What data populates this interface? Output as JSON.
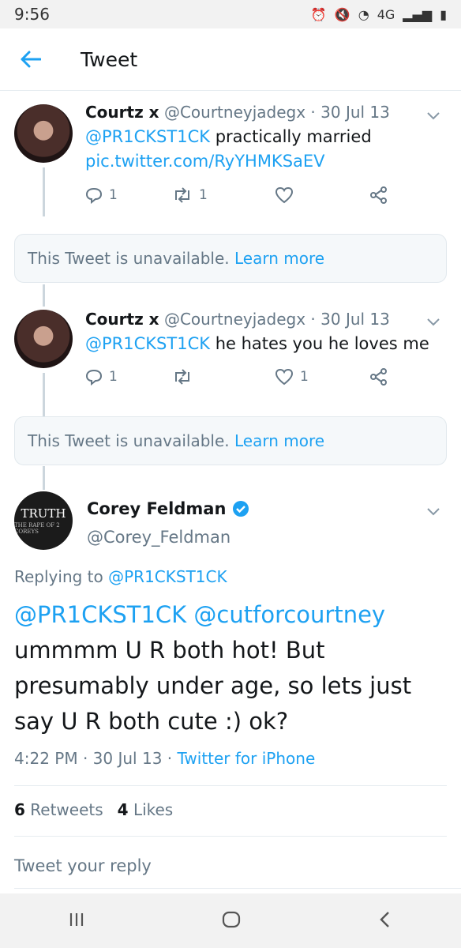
{
  "status_bar": {
    "time": "9:56",
    "network": "4G"
  },
  "app_bar": {
    "title": "Tweet"
  },
  "tweets": [
    {
      "name": "Courtz x",
      "handle": "@Courtneyjadegx",
      "sep": "·",
      "date": "30 Jul 13",
      "mention": "@PR1CKST1CK",
      "text": "practically married",
      "link": "pic.twitter.com/RyYHMKSaEV",
      "replies": "1",
      "retweets": "1",
      "likes": ""
    },
    {
      "name": "Courtz x",
      "handle": "@Courtneyjadegx",
      "sep": "·",
      "date": "30 Jul 13",
      "mention": "@PR1CKST1CK",
      "text": "he hates you he loves me",
      "replies": "1",
      "retweets": "",
      "likes": "1"
    }
  ],
  "unavailable": {
    "text": "This Tweet is unavailable.",
    "link": "Learn more"
  },
  "main_tweet": {
    "name": "Corey Feldman",
    "handle": "@Corey_Feldman",
    "avatar_text": "TRUTH",
    "avatar_sub": "THE RAPE OF 2 COREYS",
    "replying_prefix": "Replying to",
    "replying_to": "@PR1CKST1CK",
    "mention1": "@PR1CKST1CK",
    "mention2": "@cutforcourtney",
    "text": "ummmm U R both hot! But presumably under age, so lets just say U R both cute :) ok?",
    "time": "4:22 PM",
    "date": "30 Jul 13",
    "source": "Twitter for iPhone",
    "sep": "·",
    "retweet_count": "6",
    "retweet_label": "Retweets",
    "like_count": "4",
    "like_label": "Likes"
  },
  "reply": {
    "placeholder": "Tweet your reply"
  },
  "colors": {
    "accent": "#1da1f2",
    "muted": "#657786",
    "verified": "#1da1f2"
  }
}
